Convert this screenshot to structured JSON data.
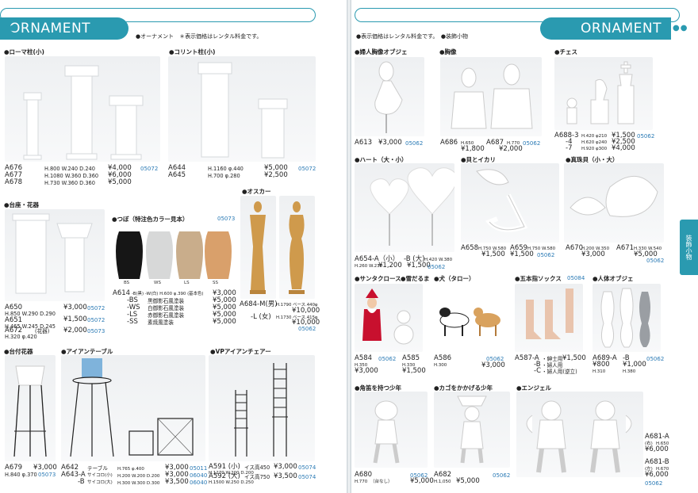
{
  "left": {
    "band_title": "ORNAMENT",
    "note": "●オーナメント　＊表示価格はレンタル料金です。",
    "sections": {
      "roma": {
        "title": "●ローマ柱(小)"
      },
      "corinth": {
        "title": "●コリント柱(小)"
      },
      "stand": {
        "title": "●台座・花器"
      },
      "vase": {
        "title": "●つぼ（特注色カラー見本）",
        "ref": "05073"
      },
      "oscar": {
        "title": "●オスカー"
      },
      "daitsuki": {
        "title": "●台付花器"
      },
      "iron_table": {
        "title": "●アイアンテーブル"
      },
      "vp_chair": {
        "title": "●VPアイアンチェアー"
      }
    },
    "items": {
      "roma_lines": [
        {
          "code": "A676",
          "dims": "H.800 W.240 D.240",
          "price": "¥4,000"
        },
        {
          "code": "A677",
          "dims": "H.1080 W.360 D.360",
          "price": "¥6,000"
        },
        {
          "code": "A678",
          "dims": "H.730 W.360 D.360",
          "price": "¥5,000"
        }
      ],
      "roma_ref": "05072",
      "corinth_lines": [
        {
          "code": "A644",
          "dims": "H.1160 φ.440",
          "price": "¥5,000"
        },
        {
          "code": "A645",
          "dims": "H.700 φ.280",
          "price": "¥2,500"
        }
      ],
      "corinth_ref": "05072",
      "stand_lines": [
        {
          "code": "A650",
          "dims": "H.850 W.290 D.290",
          "price": "¥3,000",
          "ref": "05072"
        },
        {
          "code": "A651",
          "dims": "H.465 W.245 D.245",
          "price": "¥1,500",
          "ref": "05072"
        },
        {
          "code": "A672",
          "dims": "H.320 φ.420",
          "note": "(花器)",
          "price": "¥2,000",
          "ref": "05073"
        }
      ],
      "vase_caps": [
        "BS",
        "WS",
        "LS",
        "SS"
      ],
      "vase_code": "A614",
      "vase_dims": "-B(黒) -W(白) H.600 φ.390 (基本色)",
      "vase_main_price": "¥3,000",
      "vase_lines": [
        {
          "code": "-BS",
          "desc": "黒御影石風塗装",
          "price": "¥5,000"
        },
        {
          "code": "-WS",
          "desc": "白御影石風塗装",
          "price": "¥5,000"
        },
        {
          "code": "-LS",
          "desc": "赤御影石風塗装",
          "price": "¥5,000"
        },
        {
          "code": "-SS",
          "desc": "素焼風塗装",
          "price": "¥5,000"
        }
      ],
      "oscar_male": {
        "code": "A684-M(男)",
        "dims": "H.1790 ベース.440φ",
        "price": "¥10,000"
      },
      "oscar_female": {
        "code": "-L (女)",
        "dims": "H.1730 ベース.415φ",
        "price": "¥10,000"
      },
      "oscar_ref": "05062",
      "daitsuki": {
        "code": "A679",
        "dims": "H.840 φ.370",
        "price": "¥3,000",
        "ref": "05073"
      },
      "iron_table_lines": [
        {
          "code": "A642",
          "name": "テーブル",
          "dims": "H.765 φ.400",
          "price": "¥3,000",
          "ref": "05011"
        },
        {
          "code": "A643-A",
          "name": "サイコロ(小)",
          "dims": "H.200 W.200 D.200",
          "price": "¥3,000",
          "ref": "06040"
        },
        {
          "code": "-B",
          "name": "サイコロ(大)",
          "dims": "H.300 W.300 D.300",
          "price": "¥3,500",
          "ref": "06040"
        }
      ],
      "vp_lines": [
        {
          "code": "A591 (小)",
          "name": "イス高450",
          "dims": "H.1270 W.200 D.200",
          "price": "¥3,000",
          "ref": "05074"
        },
        {
          "code": "A592 (大)",
          "name": "イス高750",
          "dims": "H.1500 W.250 D.250",
          "price": "¥3,500",
          "ref": "05074"
        }
      ]
    }
  },
  "right": {
    "band_title": "ORNAMENT",
    "note": "●表示価格はレンタル料金です。　●装飾小物",
    "side_tab": "装飾小物",
    "sections": {
      "fujin": {
        "title": "●婦人胸像オブジェ"
      },
      "kyozo": {
        "title": "●胸像"
      },
      "chess": {
        "title": "●チェス"
      },
      "heart": {
        "title": "●ハート（大・小）"
      },
      "kai": {
        "title": "●貝とイカリ"
      },
      "shinju": {
        "title": "●真珠貝（小・大）"
      },
      "santa": {
        "title": "●サンタクロース"
      },
      "yuki": {
        "title": "●雪だるま"
      },
      "dog": {
        "title": "●犬（タロー）"
      },
      "socks": {
        "title": "●五本指ソックス",
        "ref": "05084"
      },
      "body": {
        "title": "●人体オブジェ"
      },
      "tsuno": {
        "title": "●角笛を持つ少年"
      },
      "kago": {
        "title": "●カゴをかかげる少年"
      },
      "angel": {
        "title": "●エンジェル"
      }
    },
    "items": {
      "fujin": {
        "code": "A613",
        "price": "¥3,000",
        "ref": "05062"
      },
      "kyozo": [
        {
          "code": "A686",
          "dims": "H.650",
          "price": "¥1,800"
        },
        {
          "code": "A687",
          "dims": "H.770",
          "price": "¥2,000"
        }
      ],
      "kyozo_ref": "05062",
      "chess_lines": [
        {
          "code": "A688-3",
          "dims": "H.420 φ210",
          "price": "¥1,500"
        },
        {
          "code": "-4",
          "dims": "H.620 φ240",
          "price": "¥2,500"
        },
        {
          "code": "-7",
          "dims": "H.920 φ300",
          "price": "¥4,000"
        }
      ],
      "chess_ref": "05062",
      "heart_small": {
        "code": "A654-A（小）",
        "dims": "H.260 W.230",
        "price": "¥1,200"
      },
      "heart_large": {
        "code": "-B (大)",
        "dims": "H.420 W.380",
        "price": "¥1,500"
      },
      "heart_ref": "05062",
      "kai": {
        "code": "A658",
        "dims": "H.750 W.580",
        "price": "¥1,500"
      },
      "ikari": {
        "code": "A659",
        "dims": "H.750 W.580",
        "price": "¥1,500",
        "ref": "05062"
      },
      "shinju_small": {
        "code": "A670",
        "dims": "H.200 W.350",
        "price": "¥3,000"
      },
      "shinju_large": {
        "code": "A671",
        "dims": "H.330 W.540",
        "price": "¥5,000"
      },
      "shinju_ref": "05062",
      "santa": {
        "code": "A584",
        "dims": "H.350",
        "price": "¥3,000"
      },
      "santa_ref": "05062",
      "yuki": {
        "code": "A585",
        "dims": "H.330",
        "price": "¥1,500"
      },
      "dog": {
        "code": "A586",
        "dims": "H.300",
        "price": "¥3,000",
        "ref": "05062"
      },
      "socks_lines": [
        {
          "code": "A587-A",
          "name": "・紳士用",
          "price": "¥1,500"
        },
        {
          "code": "-B",
          "name": "・婦人用",
          "price": ""
        },
        {
          "code": "-C",
          "name": "・婦人用(逆立)",
          "price": ""
        }
      ],
      "body_a": {
        "code": "A689-A",
        "dims": "H.310",
        "price": "¥800"
      },
      "body_b": {
        "code": "-B",
        "dims": "H.380",
        "price": "¥1,000"
      },
      "body_ref": "05062",
      "tsuno": {
        "code": "A680",
        "dims": "H.770",
        "note": "（台なし）",
        "price": "¥5,000",
        "ref": "05062"
      },
      "kago": {
        "code": "A682",
        "dims": "H.1,050",
        "price": "¥5,000",
        "ref": "05062"
      },
      "angel_a": {
        "code": "A681-A",
        "side": "(右)",
        "dims": "H.650",
        "price": "¥6,000"
      },
      "angel_b": {
        "code": "A681-B",
        "side": "(左)",
        "dims": "H.670",
        "price": "¥6,000"
      },
      "angel_ref": "05062"
    }
  }
}
